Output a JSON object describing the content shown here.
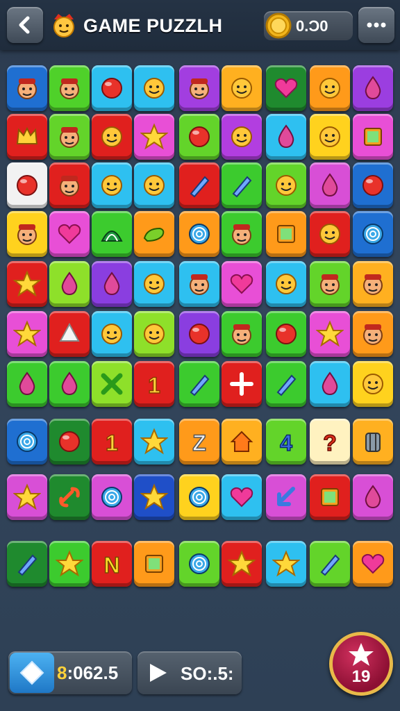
{
  "header": {
    "title": "GAME PUZZLH",
    "coins": "0.Ɔ0",
    "back_icon": "back-arrow-icon",
    "menu_icon": "more-dots-icon"
  },
  "footer": {
    "timer": ":062.5",
    "timer_prefix": "8",
    "score": "SO:.5:",
    "level": "19"
  },
  "rows": [
    [
      [
        "#1f6fd1",
        "face"
      ],
      [
        "#4fd12a",
        "face"
      ],
      [
        "#2ec0f0",
        "ball"
      ],
      [
        "#2ec0f0",
        "smile"
      ],
      [
        "#a23ee0",
        "face"
      ],
      [
        "#ffb020",
        "smile"
      ],
      [
        "#1f8a2e",
        "heart"
      ],
      [
        "#ff9a1a",
        "smile"
      ],
      [
        "#9b3ee0",
        "drop"
      ]
    ],
    [
      [
        "#e0201e",
        "crown"
      ],
      [
        "#63d42a",
        "face"
      ],
      [
        "#e0201e",
        "smile"
      ],
      [
        "#e84fd6",
        "star"
      ],
      [
        "#63d42a",
        "ball"
      ],
      [
        "#b23ee0",
        "smile"
      ],
      [
        "#2ec0f0",
        "drop"
      ],
      [
        "#ffd21e",
        "smile"
      ],
      [
        "#e84fd6",
        "square"
      ]
    ],
    [
      [
        "#f2f2f2",
        "ball"
      ],
      [
        "#e0201e",
        "face"
      ],
      [
        "#2ec0f0",
        "smile"
      ],
      [
        "#2ec0f0",
        "smile"
      ],
      [
        "#e0201e",
        "pencil"
      ],
      [
        "#3ccb2e",
        "pencil"
      ],
      [
        "#63d42a",
        "smile"
      ],
      [
        "#d84fd6",
        "drop"
      ],
      [
        "#1f6fd1",
        "ball"
      ]
    ],
    [
      [
        "#ffd21e",
        "face"
      ],
      [
        "#e84fd6",
        "heart"
      ],
      [
        "#3ccb2e",
        "shell"
      ],
      [
        "#ff9a1a",
        "bean"
      ],
      [
        "#ff9a1a",
        "swirl"
      ],
      [
        "#3ccb2e",
        "face"
      ],
      [
        "#ff9a1a",
        "square"
      ],
      [
        "#e0201e",
        "smile"
      ],
      [
        "#1f6fd1",
        "swirl"
      ]
    ],
    [
      [
        "#e0201e",
        "star"
      ],
      [
        "#8ee02a",
        "drop"
      ],
      [
        "#8a3ee0",
        "drop"
      ],
      [
        "#2ec0f0",
        "smile"
      ],
      [
        "#2ec0f0",
        "face"
      ],
      [
        "#e84fd6",
        "heart"
      ],
      [
        "#2ec0f0",
        "smile"
      ],
      [
        "#63d42a",
        "face"
      ],
      [
        "#ffb020",
        "face"
      ]
    ],
    [
      [
        "#e84fd6",
        "star"
      ],
      [
        "#e0201e",
        "cone"
      ],
      [
        "#2ec0f0",
        "smile"
      ],
      [
        "#8ee02a",
        "smile"
      ],
      [
        "#8a3ee0",
        "ball"
      ],
      [
        "#3ccb2e",
        "face"
      ],
      [
        "#3ccb2e",
        "ball"
      ],
      [
        "#e84fd6",
        "star"
      ],
      [
        "#ff9a1a",
        "face"
      ]
    ],
    [
      [
        "#3ccb2e",
        "drop"
      ],
      [
        "#3ccb2e",
        "drop"
      ],
      [
        "#8ee02a",
        "cross"
      ],
      [
        "#e0201e",
        "one"
      ],
      [
        "#3ccb2e",
        "pencil"
      ],
      [
        "#e0201e",
        "plus"
      ],
      [
        "#3ccb2e",
        "pencil"
      ],
      [
        "#2ec0f0",
        "drop"
      ],
      [
        "#ffd21e",
        "smile"
      ]
    ],
    [
      [
        "#1f6fd1",
        "swirl"
      ],
      [
        "#1f8a2e",
        "ball"
      ],
      [
        "#e0201e",
        "one"
      ],
      [
        "#2ec0f0",
        "star"
      ],
      [
        "#ff9a1a",
        "zed"
      ],
      [
        "#ffb020",
        "house"
      ],
      [
        "#63d42a",
        "four"
      ],
      [
        "#fff2c0",
        "q"
      ],
      [
        "#ffb020",
        "can"
      ]
    ],
    [
      [
        "#d84fd6",
        "star"
      ],
      [
        "#1f8a2e",
        "link"
      ],
      [
        "#d84fd6",
        "swirl"
      ],
      [
        "#1f4fc8",
        "star"
      ],
      [
        "#ffd21e",
        "swirl"
      ],
      [
        "#2ec0f0",
        "heart"
      ],
      [
        "#d84fd6",
        "arrow"
      ],
      [
        "#e0201e",
        "square"
      ],
      [
        "#d84fd6",
        "drop"
      ]
    ],
    [
      [
        "#1f8a2e",
        "pencil"
      ],
      [
        "#3ccb2e",
        "star"
      ],
      [
        "#e0201e",
        "en"
      ],
      [
        "#ff9a1a",
        "square"
      ],
      [
        "#63d42a",
        "swirl"
      ],
      [
        "#e0201e",
        "star"
      ],
      [
        "#2ec0f0",
        "star"
      ],
      [
        "#63d42a",
        "pencil"
      ],
      [
        "#ff9a1a",
        "heart"
      ]
    ]
  ]
}
